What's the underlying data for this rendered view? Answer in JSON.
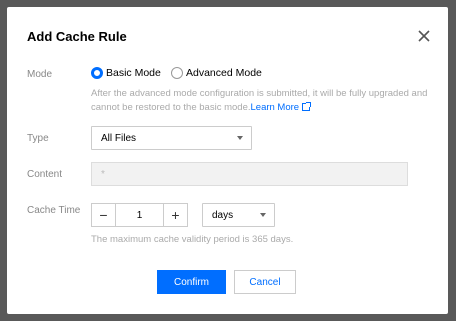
{
  "dialog": {
    "title": "Add Cache Rule",
    "close_icon": "close-icon"
  },
  "mode": {
    "label": "Mode",
    "options": [
      "Basic Mode",
      "Advanced Mode"
    ],
    "selected": "Basic Mode",
    "hint": "After the advanced mode configuration is submitted, it will be fully upgraded and cannot be restored to the basic mode.",
    "link_text": "Learn More",
    "link_icon": "external-link-icon"
  },
  "type": {
    "label": "Type",
    "value": "All Files"
  },
  "content": {
    "label": "Content",
    "value": "*"
  },
  "cache_time": {
    "label": "Cache Time",
    "minus": "−",
    "value": "1",
    "plus": "+",
    "unit": "days",
    "hint": "The maximum cache validity period is 365 days."
  },
  "footer": {
    "confirm": "Confirm",
    "cancel": "Cancel"
  },
  "colors": {
    "accent": "#006eff",
    "overlay": "#595959"
  }
}
